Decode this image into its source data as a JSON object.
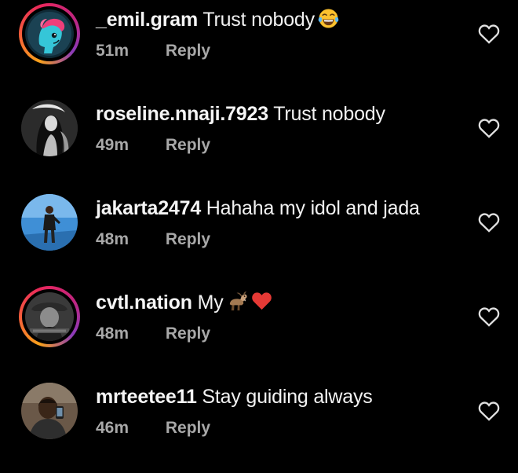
{
  "comments": [
    {
      "username": "_emil.gram",
      "text": "Trust nobody",
      "emojis": [
        "face-with-tears-of-joy-emoji"
      ],
      "time": "51m",
      "reply_label": "Reply",
      "has_story_ring": true,
      "like_icon": "heart-outline-icon"
    },
    {
      "username": "roseline.nnaji.7923",
      "text": "Trust nobody",
      "emojis": [],
      "time": "49m",
      "reply_label": "Reply",
      "has_story_ring": false,
      "like_icon": "heart-outline-icon"
    },
    {
      "username": "jakarta2474",
      "text": "Hahaha my idol and jada",
      "emojis": [],
      "time": "48m",
      "reply_label": "Reply",
      "has_story_ring": false,
      "like_icon": "heart-outline-icon"
    },
    {
      "username": "cvtl.nation",
      "text": "My",
      "emojis": [
        "goat-emoji",
        "red-heart-emoji"
      ],
      "time": "48m",
      "reply_label": "Reply",
      "has_story_ring": true,
      "like_icon": "heart-outline-icon"
    },
    {
      "username": "mrteetee11",
      "text": "Stay guiding always",
      "emojis": [],
      "time": "46m",
      "reply_label": "Reply",
      "has_story_ring": false,
      "like_icon": "heart-outline-icon"
    }
  ],
  "colors": {
    "background": "#000000",
    "text_primary": "#f5f5f5",
    "text_secondary": "#a8a8a8",
    "story_ring": [
      "#f9a11b",
      "#e8265c",
      "#8a3ab9"
    ]
  }
}
